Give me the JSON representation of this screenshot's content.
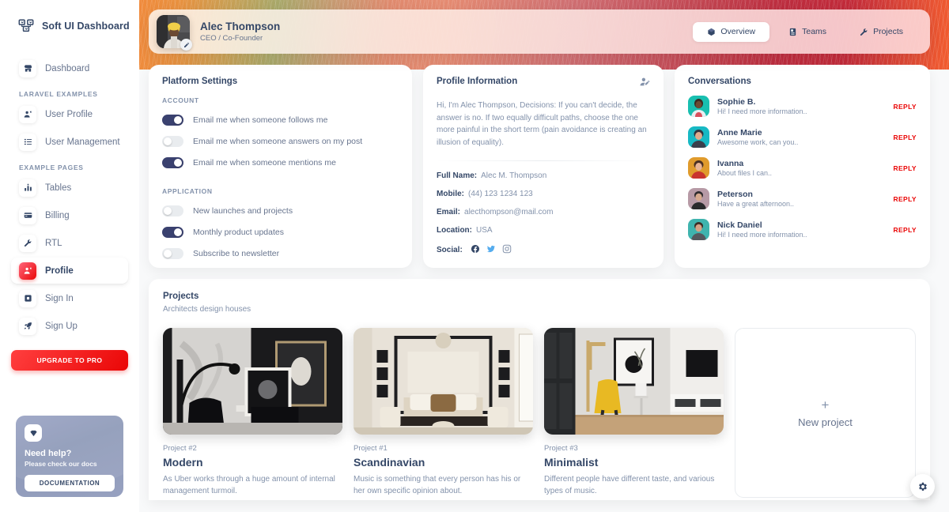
{
  "brand": {
    "name": "Soft UI Dashboard",
    "logo_icon": "soft-ui-logo-icon"
  },
  "sidebar": {
    "groups": [
      {
        "label": "",
        "items": [
          {
            "label": "Dashboard",
            "icon": "shop-icon",
            "active": false
          }
        ]
      },
      {
        "label": "LARAVEL EXAMPLES",
        "items": [
          {
            "label": "User Profile",
            "icon": "user-icon",
            "active": false
          },
          {
            "label": "User Management",
            "icon": "list-icon",
            "active": false
          }
        ]
      },
      {
        "label": "EXAMPLE PAGES",
        "items": [
          {
            "label": "Tables",
            "icon": "chart-icon",
            "active": false
          },
          {
            "label": "Billing",
            "icon": "credit-card-icon",
            "active": false
          },
          {
            "label": "RTL",
            "icon": "tools-icon",
            "active": false
          },
          {
            "label": "Profile",
            "icon": "user-icon",
            "active": true
          },
          {
            "label": "Sign In",
            "icon": "login-icon",
            "active": false
          },
          {
            "label": "Sign Up",
            "icon": "rocket-icon",
            "active": false
          }
        ]
      }
    ],
    "upgrade_label": "UPGRADE TO PRO",
    "help": {
      "icon": "diamond-icon",
      "title": "Need help?",
      "subtitle": "Please check our docs",
      "button_label": "DOCUMENTATION"
    }
  },
  "header": {
    "avatar": "user-avatar",
    "edit_icon": "pencil-icon",
    "name": "Alec Thompson",
    "role": "CEO / Co-Founder",
    "tabs": [
      {
        "label": "Overview",
        "icon": "cube-icon",
        "active": true
      },
      {
        "label": "Teams",
        "icon": "document-icon",
        "active": false
      },
      {
        "label": "Projects",
        "icon": "tools-icon",
        "active": false
      }
    ]
  },
  "platform_settings": {
    "title": "Platform Settings",
    "sections": [
      {
        "label": "ACCOUNT",
        "items": [
          {
            "label": "Email me when someone follows me",
            "on": true
          },
          {
            "label": "Email me when someone answers on my post",
            "on": false
          },
          {
            "label": "Email me when someone mentions me",
            "on": true
          }
        ]
      },
      {
        "label": "APPLICATION",
        "items": [
          {
            "label": "New launches and projects",
            "on": false
          },
          {
            "label": "Monthly product updates",
            "on": true
          },
          {
            "label": "Subscribe to newsletter",
            "on": false
          }
        ]
      }
    ]
  },
  "profile_information": {
    "title": "Profile Information",
    "edit_icon": "edit-user-icon",
    "bio": "Hi, I'm Alec Thompson, Decisions: If you can't decide, the answer is no. If two equally difficult paths, choose the one more painful in the short term (pain avoidance is creating an illusion of equality).",
    "fields": [
      {
        "label": "Full Name:",
        "value": "Alec M. Thompson"
      },
      {
        "label": "Mobile:",
        "value": "(44) 123 1234 123"
      },
      {
        "label": "Email:",
        "value": "alecthompson@mail.com"
      },
      {
        "label": "Location:",
        "value": "USA"
      }
    ],
    "social_label": "Social:",
    "social": [
      {
        "name": "facebook-icon",
        "color": "#344767"
      },
      {
        "name": "twitter-icon",
        "color": "#55acee"
      },
      {
        "name": "instagram-icon",
        "color": "#8392ab"
      }
    ]
  },
  "conversations": {
    "title": "Conversations",
    "reply_label": "REPLY",
    "items": [
      {
        "name": "Sophie B.",
        "message": "Hi! I need more information..",
        "avatar_color": "#19bfb0"
      },
      {
        "name": "Anne Marie",
        "message": "Awesome work, can you..",
        "avatar_color": "#17b9c4"
      },
      {
        "name": "Ivanna",
        "message": "About files I can..",
        "avatar_color": "#e09b2c"
      },
      {
        "name": "Peterson",
        "message": "Have a great afternoon..",
        "avatar_color": "#b79aa6"
      },
      {
        "name": "Nick Daniel",
        "message": "Hi! I need more information..",
        "avatar_color": "#3fb4ae"
      }
    ]
  },
  "projects": {
    "title": "Projects",
    "subtitle": "Architects design houses",
    "items": [
      {
        "num": "Project #2",
        "name": "Modern",
        "desc": "As Uber works through a huge amount of internal management turmoil."
      },
      {
        "num": "Project #1",
        "name": "Scandinavian",
        "desc": "Music is something that every person has his or her own specific opinion about."
      },
      {
        "num": "Project #3",
        "name": "Minimalist",
        "desc": "Different people have different taste, and various types of music."
      }
    ],
    "new_project": {
      "plus": "+",
      "label": "New project"
    }
  },
  "fab": {
    "icon": "gear-icon"
  },
  "colors": {
    "accent": "#ea0606",
    "dark": "#344767",
    "muted": "#8392ab",
    "switch_on": "#3a416f"
  }
}
